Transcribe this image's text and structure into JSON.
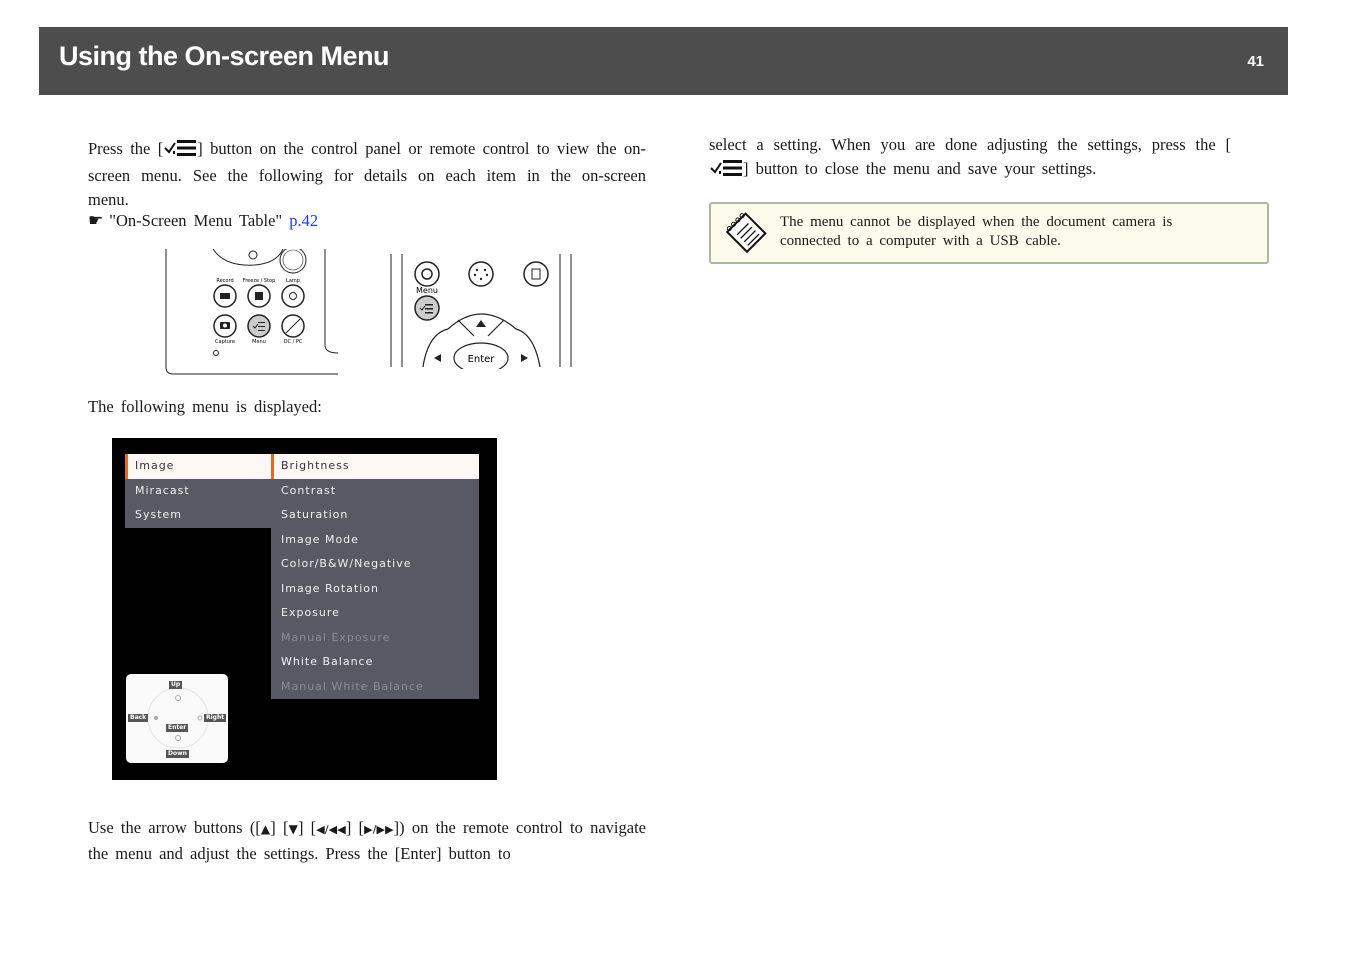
{
  "header": {
    "title": "Using the On-screen Menu",
    "page_number": "41"
  },
  "left_column": {
    "intro": {
      "part1": "Press the [",
      "part2": "] button on the control panel or remote control to view the on-screen menu. See the following for details on each item in the on-screen menu."
    },
    "reference": {
      "icon": "pointing-hand-icon",
      "glyph": "☛",
      "text": "\"On-Screen Menu Table\"",
      "link": "p.42"
    },
    "control_panel_image": {
      "labels": [
        "Record",
        "Freeze / Stop",
        "Lamp",
        "Capture",
        "Menu",
        "DC / PC"
      ]
    },
    "remote_image": {
      "menu_label": "Menu",
      "enter_label": "Enter"
    },
    "menu_caption": "The following menu is displayed:",
    "osd": {
      "left_items": [
        {
          "label": "Image",
          "selected": true
        },
        {
          "label": "Miracast",
          "selected": false
        },
        {
          "label": "System",
          "selected": false
        }
      ],
      "right_items": [
        {
          "label": "Brightness",
          "state": "selected"
        },
        {
          "label": "Contrast",
          "state": "normal"
        },
        {
          "label": "Saturation",
          "state": "normal"
        },
        {
          "label": "Image Mode",
          "state": "normal"
        },
        {
          "label": "Color/B&W/Negative",
          "state": "normal"
        },
        {
          "label": "Image Rotation",
          "state": "normal"
        },
        {
          "label": "Exposure",
          "state": "normal"
        },
        {
          "label": "Manual Exposure",
          "state": "disabled"
        },
        {
          "label": "White Balance",
          "state": "normal"
        },
        {
          "label": "Manual White Balance",
          "state": "disabled"
        }
      ],
      "nav_guide": {
        "up": "Up",
        "down": "Down",
        "back": "Back",
        "right": "Right",
        "enter": "Enter"
      },
      "accent_color": "#e86a1c"
    },
    "arrows_para": {
      "line1_a": "Use the arrow buttons ([",
      "up": "▲",
      "mid1": "] [",
      "down": "▼",
      "mid2": "] [",
      "left": "◀/◀◀",
      "mid3": "] [",
      "right": "▶/▶▶",
      "line1_b": "]) on the remote control to navigate the menu and adjust the settings. Press the [Enter] button to"
    }
  },
  "right_column": {
    "continuation": {
      "part1": "select a setting. When you are done adjusting the settings, press the [",
      "part2": "] button to close the menu and save your settings."
    },
    "note": {
      "icon": "notepad-icon",
      "text": "The menu cannot be displayed when the document camera is connected to a computer with a USB cable."
    }
  }
}
